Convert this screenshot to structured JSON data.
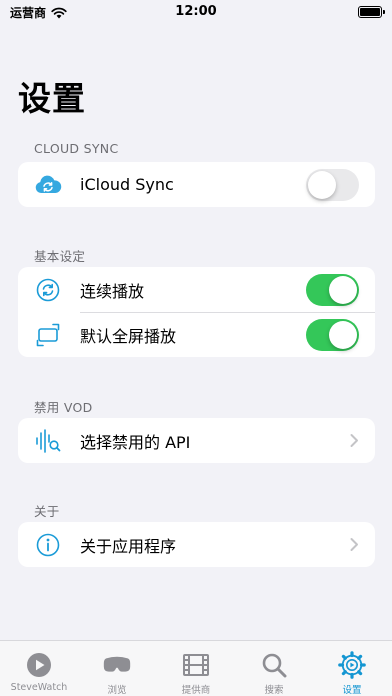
{
  "status_bar": {
    "carrier": "运营商",
    "time": "12:00"
  },
  "page": {
    "title": "设置"
  },
  "sections": [
    {
      "header": "CLOUD SYNC",
      "rows": [
        {
          "label": "iCloud Sync",
          "icon": "icloud-sync-icon",
          "control": "toggle",
          "enabled": false
        }
      ]
    },
    {
      "header": "基本设定",
      "rows": [
        {
          "label": "连续播放",
          "icon": "continuous-play-icon",
          "control": "toggle",
          "enabled": true
        },
        {
          "label": "默认全屏播放",
          "icon": "fullscreen-icon",
          "control": "toggle",
          "enabled": true
        }
      ]
    },
    {
      "header": "禁用 VOD",
      "rows": [
        {
          "label": "选择禁用的 API",
          "icon": "audio-search-icon",
          "control": "chevron"
        }
      ]
    },
    {
      "header": "关于",
      "rows": [
        {
          "label": "关于应用程序",
          "icon": "info-icon",
          "control": "chevron"
        }
      ]
    }
  ],
  "tab_bar": {
    "items": [
      {
        "label": "SteveWatch",
        "icon": "play-circle-icon",
        "active": false
      },
      {
        "label": "浏览",
        "icon": "vr-headset-icon",
        "active": false
      },
      {
        "label": "提供商",
        "icon": "film-icon",
        "active": false
      },
      {
        "label": "搜索",
        "icon": "magnifier-icon",
        "active": false
      },
      {
        "label": "设置",
        "icon": "gear-icon",
        "active": true
      }
    ]
  },
  "colors": {
    "accent": "#1496d2",
    "toggle_on": "#34c759",
    "toggle_off": "#e9e9eb",
    "background": "#f2f2f7",
    "section_header": "#6d6d72"
  }
}
